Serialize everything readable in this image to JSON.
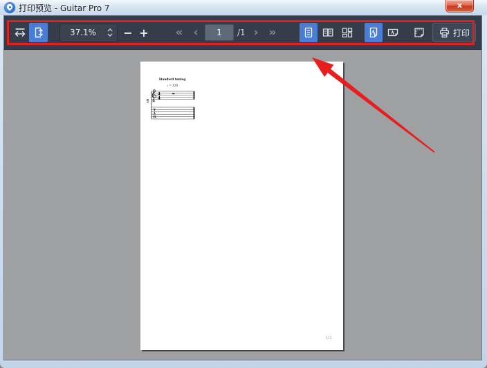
{
  "window": {
    "title": "打印预览 - Guitar Pro 7",
    "close_glyph": "x"
  },
  "toolbar": {
    "zoom": {
      "value": "37.1%",
      "minus": "−",
      "plus": "+"
    },
    "pager": {
      "first": "«",
      "prev": "‹",
      "current": "1",
      "total": "/1",
      "next": "›",
      "last": "»"
    },
    "print": {
      "label": "打印"
    }
  },
  "document": {
    "tuning": "Standard tuning",
    "tempo": "♩ = 120",
    "time_top": "4",
    "time_bottom": "4",
    "tab": "TAB",
    "page_number": "1/1"
  },
  "colors": {
    "toolbar_bg": "#353d4a",
    "selected_blue": "#4a7ed6",
    "annotation_red": "#e61e1e",
    "canvas_gray": "#9fa0a2",
    "titlebar_blue": "#d7e4f2"
  }
}
